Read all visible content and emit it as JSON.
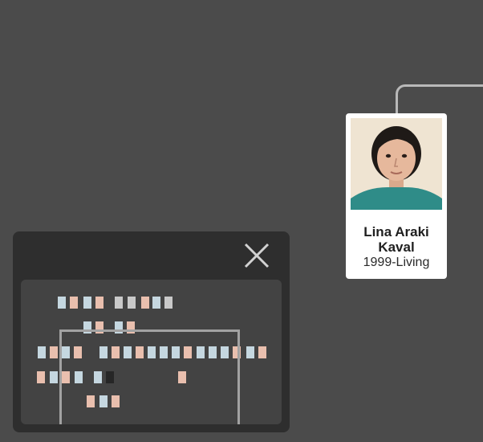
{
  "person": {
    "name": "Lina Araki Kaval",
    "dates": "1999-Living"
  },
  "minimap": {
    "close_icon": "close-icon",
    "node_colors": {
      "male": "#c5d7e0",
      "female": "#e9bfae",
      "unknown": "#c9c9c9",
      "selected": "#262626"
    }
  },
  "colors": {
    "canvas_background": "#4b4b4b",
    "panel_background": "#2e2e2e",
    "connector_line": "#b9b9b9"
  }
}
